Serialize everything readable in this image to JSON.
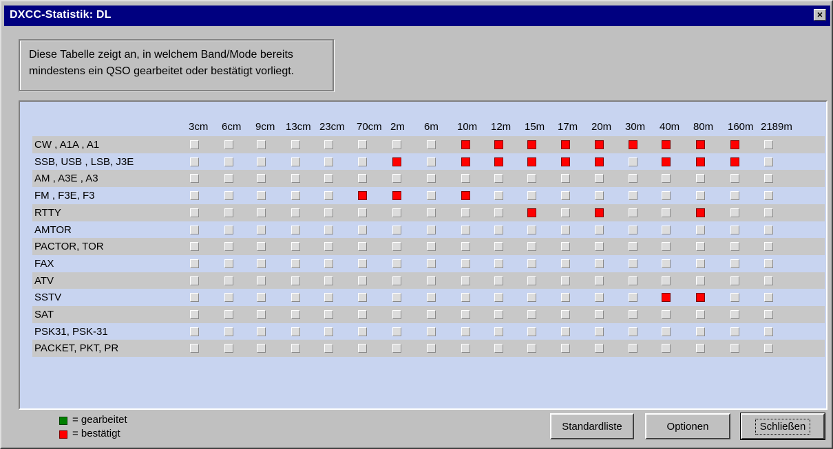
{
  "window": {
    "title": "DXCC-Statistik:  DL",
    "close_label": "×"
  },
  "info": {
    "line1": "Diese Tabelle zeigt an, in welchem Band/Mode bereits",
    "line2": "mindestens ein QSO gearbeitet oder bestätigt vorliegt."
  },
  "bands": [
    "3cm",
    "6cm",
    "9cm",
    "13cm",
    "23cm",
    "70cm",
    "2m",
    "6m",
    "10m",
    "12m",
    "15m",
    "17m",
    "20m",
    "30m",
    "40m",
    "80m",
    "160m",
    "2189m"
  ],
  "modes": [
    {
      "label": "CW , A1A , A1",
      "status": [
        0,
        0,
        0,
        0,
        0,
        0,
        0,
        0,
        2,
        2,
        2,
        2,
        2,
        2,
        2,
        2,
        2,
        0
      ]
    },
    {
      "label": "SSB, USB , LSB, J3E",
      "status": [
        0,
        0,
        0,
        0,
        0,
        0,
        2,
        0,
        2,
        2,
        2,
        2,
        2,
        0,
        2,
        2,
        2,
        0
      ]
    },
    {
      "label": "AM , A3E , A3",
      "status": [
        0,
        0,
        0,
        0,
        0,
        0,
        0,
        0,
        0,
        0,
        0,
        0,
        0,
        0,
        0,
        0,
        0,
        0
      ]
    },
    {
      "label": "FM , F3E,  F3",
      "status": [
        0,
        0,
        0,
        0,
        0,
        2,
        2,
        0,
        2,
        0,
        0,
        0,
        0,
        0,
        0,
        0,
        0,
        0
      ]
    },
    {
      "label": "RTTY",
      "status": [
        0,
        0,
        0,
        0,
        0,
        0,
        0,
        0,
        0,
        0,
        2,
        0,
        2,
        0,
        0,
        2,
        0,
        0
      ]
    },
    {
      "label": "AMTOR",
      "status": [
        0,
        0,
        0,
        0,
        0,
        0,
        0,
        0,
        0,
        0,
        0,
        0,
        0,
        0,
        0,
        0,
        0,
        0
      ]
    },
    {
      "label": "PACTOR, TOR",
      "status": [
        0,
        0,
        0,
        0,
        0,
        0,
        0,
        0,
        0,
        0,
        0,
        0,
        0,
        0,
        0,
        0,
        0,
        0
      ]
    },
    {
      "label": "FAX",
      "status": [
        0,
        0,
        0,
        0,
        0,
        0,
        0,
        0,
        0,
        0,
        0,
        0,
        0,
        0,
        0,
        0,
        0,
        0
      ]
    },
    {
      "label": "ATV",
      "status": [
        0,
        0,
        0,
        0,
        0,
        0,
        0,
        0,
        0,
        0,
        0,
        0,
        0,
        0,
        0,
        0,
        0,
        0
      ]
    },
    {
      "label": "SSTV",
      "status": [
        0,
        0,
        0,
        0,
        0,
        0,
        0,
        0,
        0,
        0,
        0,
        0,
        0,
        0,
        2,
        2,
        0,
        0
      ]
    },
    {
      "label": "SAT",
      "status": [
        0,
        0,
        0,
        0,
        0,
        0,
        0,
        0,
        0,
        0,
        0,
        0,
        0,
        0,
        0,
        0,
        0,
        0
      ]
    },
    {
      "label": "PSK31, PSK-31",
      "status": [
        0,
        0,
        0,
        0,
        0,
        0,
        0,
        0,
        0,
        0,
        0,
        0,
        0,
        0,
        0,
        0,
        0,
        0
      ]
    },
    {
      "label": "PACKET, PKT, PR",
      "status": [
        0,
        0,
        0,
        0,
        0,
        0,
        0,
        0,
        0,
        0,
        0,
        0,
        0,
        0,
        0,
        0,
        0,
        0
      ]
    }
  ],
  "status_legend": {
    "0": "empty",
    "1": "worked",
    "2": "confirmed"
  },
  "legend": {
    "worked": {
      "label": "= gearbeitet",
      "color": "#008000"
    },
    "confirmed": {
      "label": "= bestätigt",
      "color": "#ff0000"
    }
  },
  "buttons": {
    "standard": "Standardliste",
    "options": "Optionen",
    "close": "Schließen"
  },
  "colors": {
    "titlebar": "#000080",
    "panel": "#c8d4f0",
    "stripe": "#c8c8c8",
    "confirmed": "#ff0000",
    "worked": "#008000"
  }
}
